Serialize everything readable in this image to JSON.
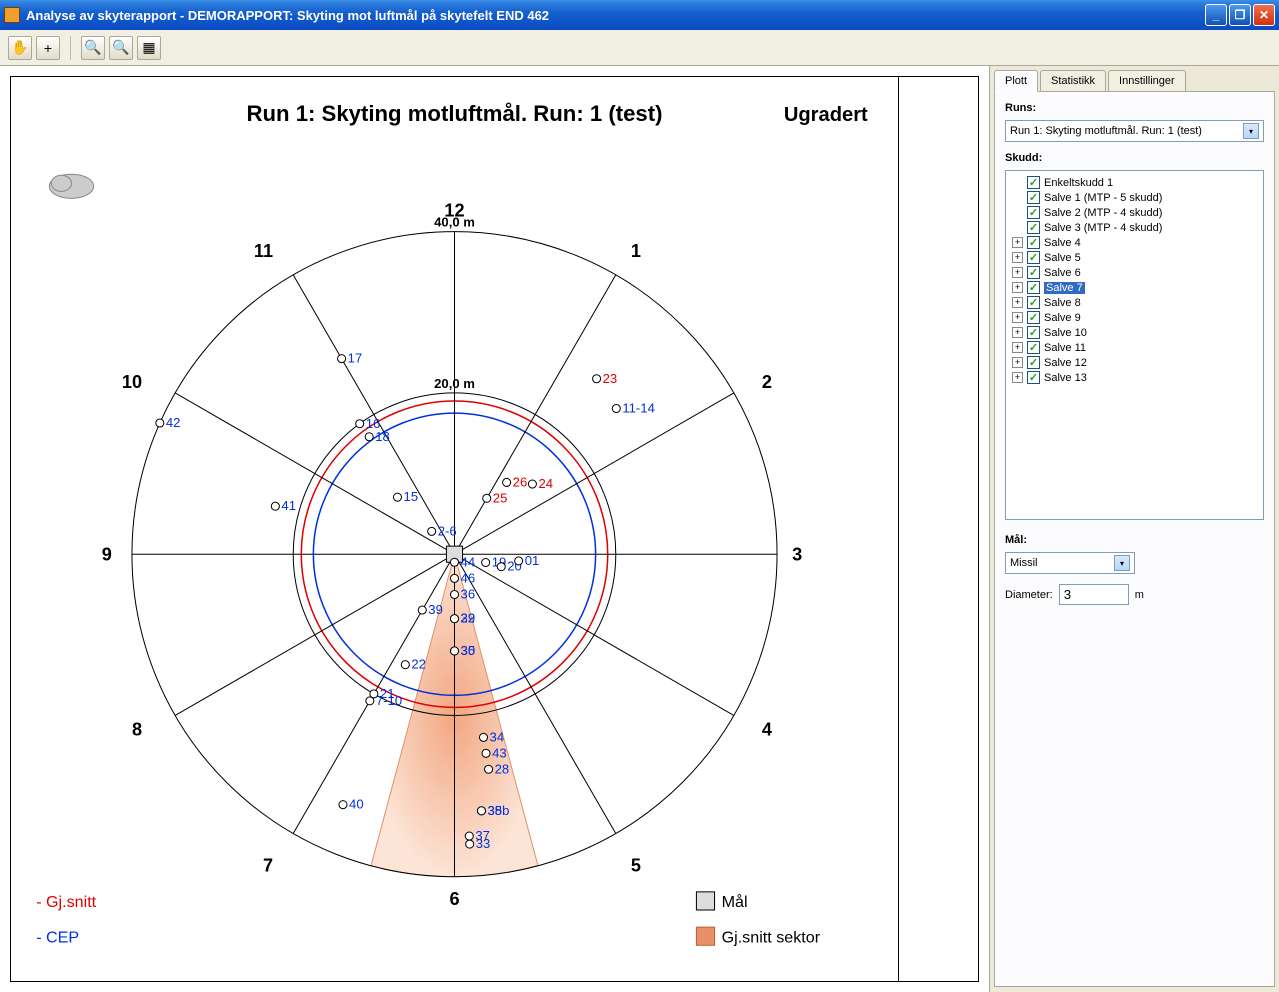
{
  "window": {
    "title": "Analyse av skyterapport - DEMORAPPORT: Skyting mot luftmål på skytefelt END 462"
  },
  "chart": {
    "title": "Run 1: Skyting motluftmål. Run: 1 (test)",
    "classification": "Ugradert",
    "ring_outer": "40,0 m",
    "ring_inner": "20,0 m",
    "legend": {
      "gjsnitt": "- Gj.snitt",
      "cep": "- CEP",
      "maal": "Mål",
      "sektor": "Gj.snitt sektor"
    }
  },
  "panel": {
    "runs_label": "Runs:",
    "runs_selected": "Run 1: Skyting motluftmål. Run: 1 (test)",
    "skudd_label": "Skudd:",
    "maal_label": "Mål:",
    "maal_selected": "Missil",
    "diameter_label": "Diameter:",
    "diameter_value": "3",
    "diameter_unit": "m",
    "tabs": {
      "plott": "Plott",
      "statistikk": "Statistikk",
      "innstillinger": "Innstillinger"
    },
    "tree": [
      {
        "label": "Enkeltskudd 1",
        "expandable": false,
        "checked": true
      },
      {
        "label": "Salve 1 (MTP - 5 skudd)",
        "expandable": false,
        "checked": true
      },
      {
        "label": "Salve 2 (MTP - 4 skudd)",
        "expandable": false,
        "checked": true
      },
      {
        "label": "Salve 3 (MTP - 4 skudd)",
        "expandable": false,
        "checked": true
      },
      {
        "label": "Salve 4",
        "expandable": true,
        "checked": true
      },
      {
        "label": "Salve 5",
        "expandable": true,
        "checked": true
      },
      {
        "label": "Salve 6",
        "expandable": true,
        "checked": true
      },
      {
        "label": "Salve 7",
        "expandable": true,
        "checked": true,
        "selected": true
      },
      {
        "label": "Salve 8",
        "expandable": true,
        "checked": true
      },
      {
        "label": "Salve 9",
        "expandable": true,
        "checked": true
      },
      {
        "label": "Salve 10",
        "expandable": true,
        "checked": true
      },
      {
        "label": "Salve 11",
        "expandable": true,
        "checked": true
      },
      {
        "label": "Salve 12",
        "expandable": true,
        "checked": true
      },
      {
        "label": "Salve 13",
        "expandable": true,
        "checked": true
      }
    ]
  },
  "chart_data": {
    "type": "scatter",
    "title": "Run 1: Skyting motluftmål. Run: 1 (test)",
    "coord": "polar",
    "radial_rings_m": [
      20.0,
      40.0
    ],
    "cep_radius_m": 17.5,
    "gjsnitt_radius_m": 19.0,
    "highlighted_sector_clock": 6,
    "clock_labels": [
      "12",
      "1",
      "2",
      "3",
      "4",
      "5",
      "6",
      "7",
      "8",
      "9",
      "10",
      "11"
    ],
    "shots": [
      {
        "id": "2-6",
        "r": 4,
        "clock": 10.5,
        "color": "blue"
      },
      {
        "id": "44",
        "r": 1,
        "clock": 6,
        "color": "blue"
      },
      {
        "id": "46",
        "r": 3,
        "clock": 6,
        "color": "blue"
      },
      {
        "id": "36",
        "r": 5,
        "clock": 6,
        "color": "blue"
      },
      {
        "id": "19",
        "r": 4,
        "clock": 3.5,
        "color": "blue"
      },
      {
        "id": "29",
        "r": 8,
        "clock": 6,
        "color": "blue"
      },
      {
        "id": "32",
        "r": 8,
        "clock": 6,
        "color": "blue"
      },
      {
        "id": "20",
        "r": 6,
        "clock": 3.5,
        "color": "blue"
      },
      {
        "id": "01",
        "r": 8,
        "clock": 3.2,
        "color": "blue"
      },
      {
        "id": "39",
        "r": 8,
        "clock": 7,
        "color": "blue"
      },
      {
        "id": "15",
        "r": 10,
        "clock": 10.5,
        "color": "blue"
      },
      {
        "id": "25",
        "r": 8,
        "clock": 1,
        "color": "red"
      },
      {
        "id": "26",
        "r": 11,
        "clock": 1.2,
        "color": "red"
      },
      {
        "id": "24",
        "r": 13,
        "clock": 1.6,
        "color": "red"
      },
      {
        "id": "35",
        "r": 12,
        "clock": 6,
        "color": "blue"
      },
      {
        "id": "30",
        "r": 12,
        "clock": 6,
        "color": "blue"
      },
      {
        "id": "22",
        "r": 15,
        "clock": 6.8,
        "color": "blue"
      },
      {
        "id": "21",
        "r": 20,
        "clock": 7,
        "color": "blue"
      },
      {
        "id": "7-10",
        "r": 21,
        "clock": 7,
        "color": "blue"
      },
      {
        "id": "16",
        "r": 20,
        "clock": 10.8,
        "color": "blue"
      },
      {
        "id": "18",
        "r": 18,
        "clock": 10.8,
        "color": "blue"
      },
      {
        "id": "41",
        "r": 23,
        "clock": 9.5,
        "color": "blue"
      },
      {
        "id": "17",
        "r": 28,
        "clock": 11,
        "color": "blue"
      },
      {
        "id": "42",
        "r": 40,
        "clock": 9.8,
        "color": "blue"
      },
      {
        "id": "23",
        "r": 28,
        "clock": 1.3,
        "color": "red"
      },
      {
        "id": "11-14",
        "r": 27,
        "clock": 1.6,
        "color": "blue"
      },
      {
        "id": "34",
        "r": 23,
        "clock": 5.7,
        "color": "blue"
      },
      {
        "id": "43",
        "r": 25,
        "clock": 5.7,
        "color": "blue"
      },
      {
        "id": "28",
        "r": 27,
        "clock": 5.7,
        "color": "blue"
      },
      {
        "id": "38",
        "r": 32,
        "clock": 5.8,
        "color": "blue"
      },
      {
        "id": "35b",
        "r": 32,
        "clock": 5.8,
        "color": "blue"
      },
      {
        "id": "37",
        "r": 35,
        "clock": 5.9,
        "color": "blue"
      },
      {
        "id": "33",
        "r": 36,
        "clock": 5.9,
        "color": "blue"
      },
      {
        "id": "40",
        "r": 34,
        "clock": 6.8,
        "color": "blue"
      }
    ]
  }
}
